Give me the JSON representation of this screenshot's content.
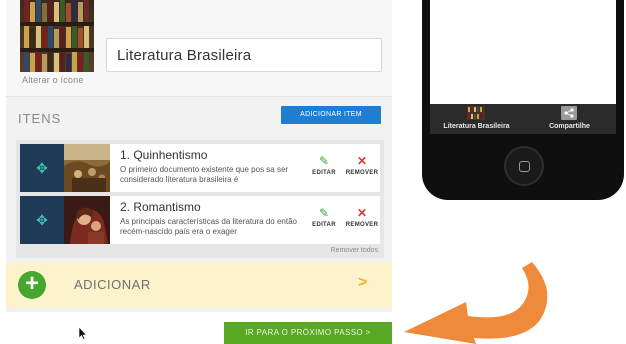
{
  "editor": {
    "change_icon_label": "Alterar o ícone",
    "title_value": "Literatura Brasileira",
    "items_heading": "ITENS",
    "add_item_button": "ADICIONAR ITEM",
    "items": [
      {
        "title": "1. Quinhentismo",
        "description": "O primeiro documento existente que pos sa ser considerado literatura brasileira é",
        "edit_label": "EDITAR",
        "remove_label": "REMOVER"
      },
      {
        "title": "2. Romantismo",
        "description": "As principais características da literatura do então recém-nascido país era o exager",
        "edit_label": "EDITAR",
        "remove_label": "REMOVER"
      }
    ],
    "remove_all_label": "Remover todos",
    "add_label": "ADICIONAR",
    "next_step_button": "IR PARA O PRÓXIMO PASSO >"
  },
  "phone": {
    "tabs": [
      {
        "label": "Literatura Brasileira",
        "icon": "bookshelf-icon"
      },
      {
        "label": "Compartilhe",
        "icon": "share-icon"
      }
    ]
  },
  "colors": {
    "accent_blue": "#1f7ed1",
    "next_green": "#58a823",
    "add_green": "#46a62e",
    "handle_navy": "#1f3b57",
    "arrow_orange": "#ef8a3a",
    "add_row_bg": "#fcf3cd"
  }
}
